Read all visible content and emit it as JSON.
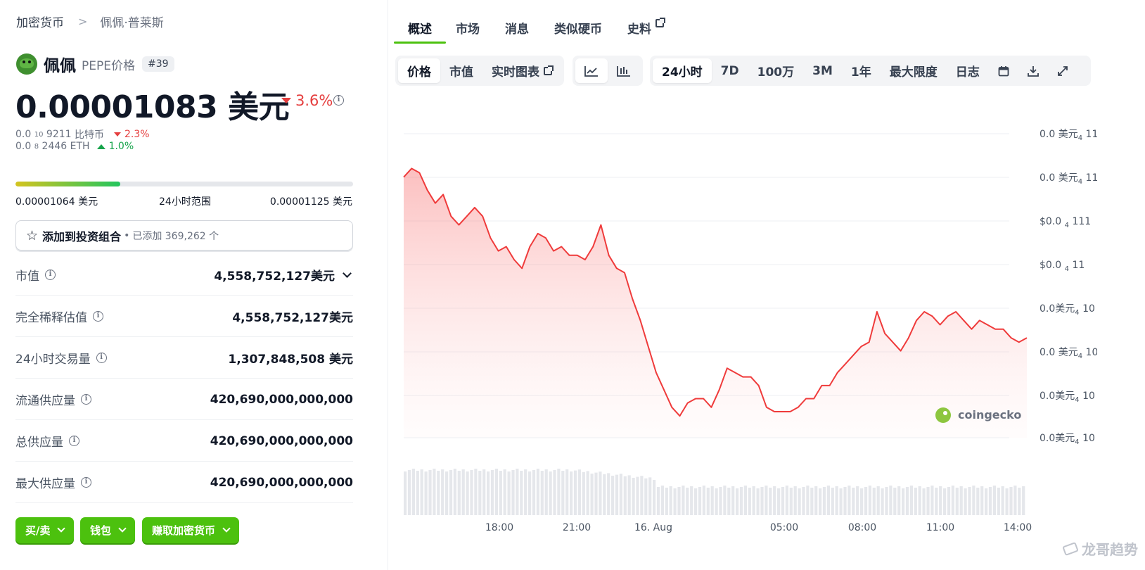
{
  "breadcrumb": {
    "root": "加密货币",
    "sep": ">",
    "current": "佩佩·普莱斯"
  },
  "coin": {
    "name": "佩佩",
    "symbol_label": "PEPE价格",
    "rank": "#39"
  },
  "price": {
    "value": "0.00001083 美元",
    "change": "3.6%",
    "change_dir": "down"
  },
  "sub_prices": [
    {
      "prefix": "0.0",
      "sub": "10",
      "digits": "9211",
      "unit": "比特币",
      "change": "2.3%",
      "dir": "down"
    },
    {
      "prefix": "0.0",
      "sub": "8",
      "digits": "2446",
      "unit": "ETH",
      "change": "1.0%",
      "dir": "up"
    }
  ],
  "range": {
    "low": "0.00001064 美元",
    "label": "24小时范围",
    "high": "0.00001125 美元",
    "position": 0.31
  },
  "portfolio": {
    "label": "添加到投资组合",
    "dot": "•",
    "added": "已添加 369,262 个"
  },
  "stats": [
    {
      "label": "市值",
      "value": "4,558,752,127美元",
      "dropdown": true
    },
    {
      "label": "完全稀释估值",
      "value": "4,558,752,127美元"
    },
    {
      "label": "24小时交易量",
      "value": "1,307,848,508 美元"
    },
    {
      "label": "流通供应量",
      "value": "420,690,000,000,000"
    },
    {
      "label": "总供应量",
      "value": "420,690,000,000,000"
    },
    {
      "label": "最大供应量",
      "value": "420,690,000,000,000"
    }
  ],
  "actions": [
    "买/卖",
    "钱包",
    "赚取加密货币"
  ],
  "tabs": [
    "概述",
    "市场",
    "消息",
    "类似硬币",
    "史料"
  ],
  "chart_toolbar": {
    "metric": [
      "价格",
      "市值",
      "实时图表"
    ],
    "ranges": [
      "24小时",
      "7D",
      "100万",
      "3M",
      "1年",
      "最大限度",
      "日志"
    ]
  },
  "colors": {
    "accent": "#4cc10e",
    "down": "#e53e3e",
    "up": "#16a34a",
    "line": "#ef3b3b"
  },
  "chart_data": {
    "type": "area",
    "x_ticks": [
      "18:00",
      "21:00",
      "16. Aug",
      "05:00",
      "08:00",
      "11:00",
      "14:00"
    ],
    "y_ticks": [
      {
        "prefix": "0.0 美元",
        "sub": "4",
        "tail": " 11"
      },
      {
        "prefix": "0.0 美元",
        "sub": "4",
        "tail": " 11"
      },
      {
        "prefix": "$0.0 ",
        "sub": "4",
        "tail": " 111"
      },
      {
        "prefix": "$0.0 ",
        "sub": "4",
        "tail": " 11"
      },
      {
        "prefix": "0.0美元",
        "sub": "4",
        "tail": " 10"
      },
      {
        "prefix": "0.0 美元",
        "sub": "4",
        "tail": " 10"
      },
      {
        "prefix": "0.0美元",
        "sub": "4",
        "tail": " 10"
      },
      {
        "prefix": "0.0美元",
        "sub": "4",
        "tail": " 10"
      }
    ],
    "ylim": [
      1.06e-05,
      1.13e-05
    ],
    "values": [
      1.12e-05,
      1.122e-05,
      1.121e-05,
      1.117e-05,
      1.114e-05,
      1.116e-05,
      1.111e-05,
      1.109e-05,
      1.111e-05,
      1.113e-05,
      1.111e-05,
      1.106e-05,
      1.103e-05,
      1.104e-05,
      1.101e-05,
      1.099e-05,
      1.104e-05,
      1.107e-05,
      1.106e-05,
      1.103e-05,
      1.104e-05,
      1.102e-05,
      1.102e-05,
      1.101e-05,
      1.104e-05,
      1.109e-05,
      1.102e-05,
      1.099e-05,
      1.098e-05,
      1.092e-05,
      1.087e-05,
      1.081e-05,
      1.075e-05,
      1.071e-05,
      1.067e-05,
      1.065e-05,
      1.068e-05,
      1.069e-05,
      1.069e-05,
      1.067e-05,
      1.071e-05,
      1.076e-05,
      1.075e-05,
      1.074e-05,
      1.074e-05,
      1.072e-05,
      1.067e-05,
      1.066e-05,
      1.066e-05,
      1.066e-05,
      1.067e-05,
      1.069e-05,
      1.069e-05,
      1.072e-05,
      1.072e-05,
      1.075e-05,
      1.077e-05,
      1.079e-05,
      1.081e-05,
      1.082e-05,
      1.089e-05,
      1.084e-05,
      1.082e-05,
      1.08e-05,
      1.083e-05,
      1.087e-05,
      1.089e-05,
      1.088e-05,
      1.086e-05,
      1.088e-05,
      1.089e-05,
      1.087e-05,
      1.085e-05,
      1.087e-05,
      1.086e-05,
      1.085e-05,
      1.085e-05,
      1.083e-05,
      1.082e-05,
      1.083e-05
    ],
    "volume_note": "bars"
  },
  "brand": {
    "watermark": "coingecko",
    "corner": "龙哥趋势"
  }
}
